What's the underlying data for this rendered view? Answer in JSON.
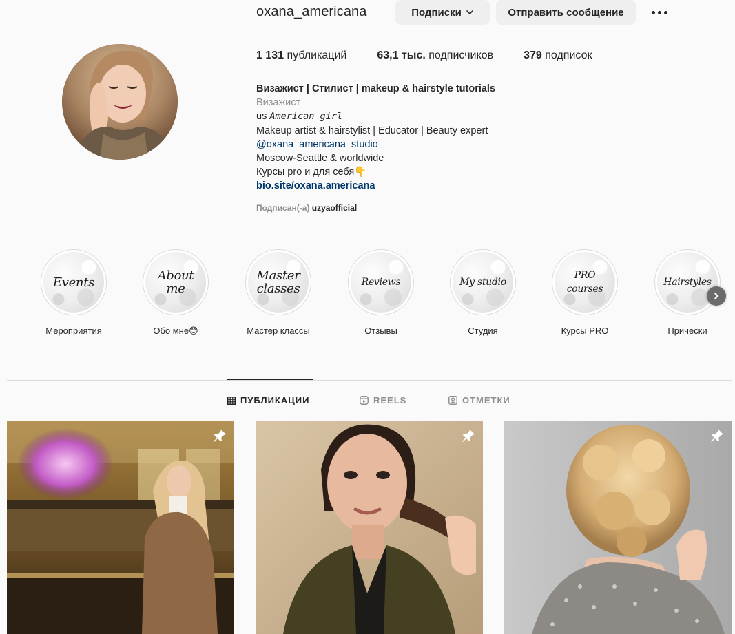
{
  "profile": {
    "username": "oxana_americana",
    "follow_button": "Подписки",
    "message_button": "Отправить сообщение",
    "avatar_icon": "profile-photo"
  },
  "stats": {
    "posts_count": "1 131",
    "posts_label": "публикаций",
    "followers_count": "63,1 тыс.",
    "followers_label": "подписчиков",
    "following_count": "379",
    "following_label": "подписок"
  },
  "bio": {
    "name": "Визажист | Стилист | makeup & hairstyle tutorials",
    "category": "Визажист",
    "line1_prefix": "us",
    "line1_text": "American girl",
    "line2": "Makeup artist & hairstylist | Educator | Beauty expert",
    "mention": "@oxana_americana_studio",
    "line4": "Moscow-Seattle & worldwide",
    "line5": "Курсы pro и для себя👇",
    "link": "bio.site/oxana.americana",
    "followed_by_prefix": "Подписан(-а)",
    "followed_by_user": "uzyaofficial"
  },
  "highlights": [
    {
      "cover_text": "Events",
      "label": "Мероприятия"
    },
    {
      "cover_text": "About\nme",
      "label": "Обо мне😊"
    },
    {
      "cover_text": "Master\nclasses",
      "label": "Мастер классы"
    },
    {
      "cover_text": "Reviews",
      "label": "Отзывы"
    },
    {
      "cover_text": "My studio",
      "label": "Студия"
    },
    {
      "cover_text": "PRO\ncourses",
      "label": "Курсы PRO"
    },
    {
      "cover_text": "Hairstyles",
      "label": "Прически"
    }
  ],
  "tabs": {
    "posts": "ПУБЛИКАЦИИ",
    "reels": "REELS",
    "tagged": "ОТМЕТКИ",
    "active": "posts"
  },
  "posts": [
    {
      "pinned": true,
      "description_icon": "photo-palace-interior"
    },
    {
      "pinned": true,
      "description_icon": "photo-makeup-portrait"
    },
    {
      "pinned": true,
      "description_icon": "photo-braided-hairstyle"
    }
  ],
  "colors": {
    "background": "#fafafa",
    "text": "#262626",
    "secondary_text": "#8e8e8e",
    "link": "#00376b",
    "button_bg": "#efefef"
  }
}
